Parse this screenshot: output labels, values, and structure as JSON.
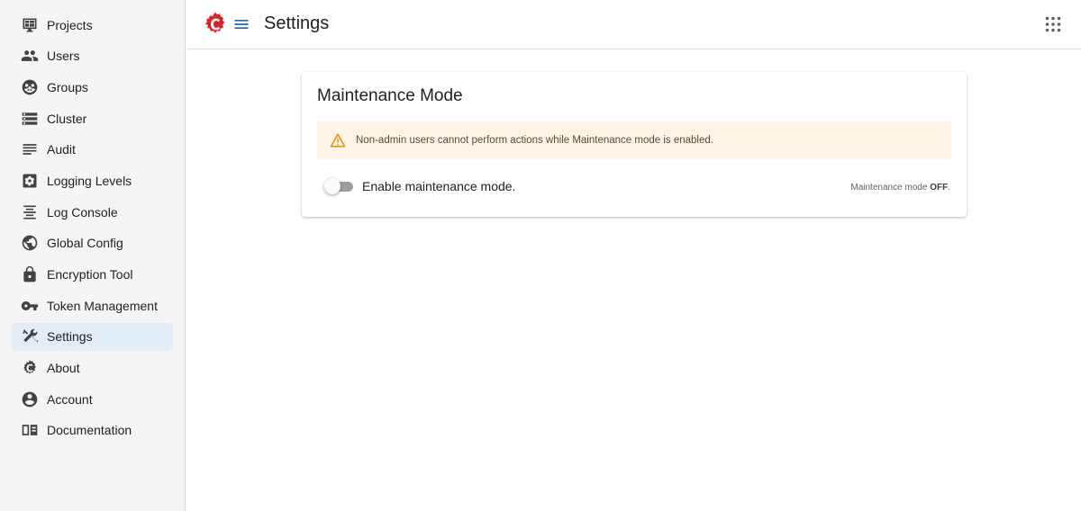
{
  "app": {
    "page_title": "Settings"
  },
  "sidebar": {
    "items": [
      {
        "label": "Projects",
        "icon": "projects-icon"
      },
      {
        "label": "Users",
        "icon": "users-icon"
      },
      {
        "label": "Groups",
        "icon": "groups-icon"
      },
      {
        "label": "Cluster",
        "icon": "cluster-icon"
      },
      {
        "label": "Audit",
        "icon": "audit-icon"
      },
      {
        "label": "Logging Levels",
        "icon": "logging-levels-icon"
      },
      {
        "label": "Log Console",
        "icon": "log-console-icon"
      },
      {
        "label": "Global Config",
        "icon": "globe-icon"
      },
      {
        "label": "Encryption Tool",
        "icon": "lock-icon"
      },
      {
        "label": "Token Management",
        "icon": "key-icon"
      },
      {
        "label": "Settings",
        "icon": "tools-icon",
        "active": true
      },
      {
        "label": "About",
        "icon": "about-logo-icon"
      },
      {
        "label": "Account",
        "icon": "account-icon"
      },
      {
        "label": "Documentation",
        "icon": "book-icon"
      }
    ]
  },
  "card": {
    "title": "Maintenance Mode",
    "alert": {
      "text": "Non-admin users cannot perform actions while Maintenance mode is enabled.",
      "icon": "warning-icon",
      "color": "#ed8b00",
      "background": "#fff4e5"
    },
    "toggle": {
      "label": "Enable maintenance mode.",
      "checked": false
    },
    "status": {
      "prefix": "Maintenance mode ",
      "value": "OFF",
      "suffix": "."
    }
  },
  "colors": {
    "accent": "#1f63b5",
    "sidebar_active_bg": "#e3edf9",
    "logo_red": "#e21e26"
  }
}
